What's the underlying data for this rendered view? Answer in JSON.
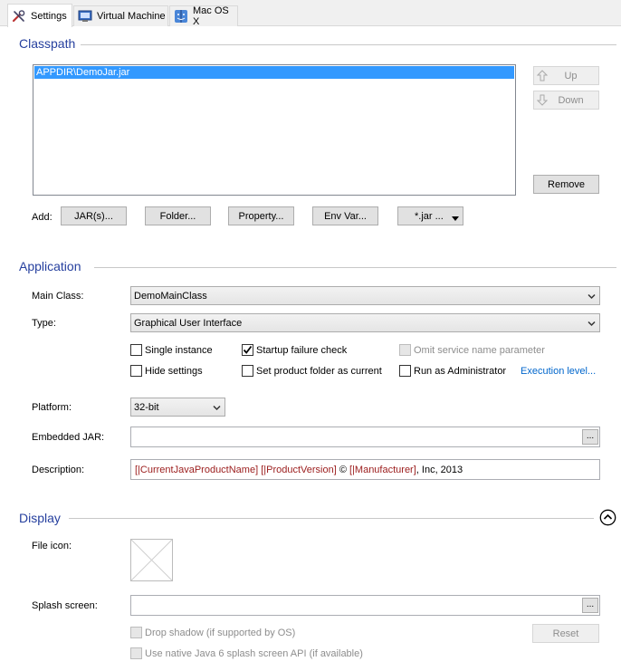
{
  "tabs": [
    {
      "label": "Settings",
      "icon": "wrench-screwdriver-icon"
    },
    {
      "label": "Virtual Machine",
      "icon": "virtual-machine-icon"
    },
    {
      "label": "Mac OS X",
      "icon": "mac-os-icon"
    }
  ],
  "classpath": {
    "title": "Classpath",
    "items": [
      "APPDIR\\DemoJar.jar"
    ],
    "up_label": "Up",
    "down_label": "Down",
    "remove_label": "Remove",
    "add_label": "Add:",
    "add_buttons": [
      "JAR(s)...",
      "Folder...",
      "Property...",
      "Env Var...",
      "*.jar ..."
    ]
  },
  "application": {
    "title": "Application",
    "main_class_label": "Main Class:",
    "main_class_value": "DemoMainClass",
    "type_label": "Type:",
    "type_value": "Graphical User Interface",
    "single_instance": "Single instance",
    "startup_failure_check": "Startup failure check",
    "omit_service_name": "Omit service name parameter",
    "hide_settings": "Hide settings",
    "set_product_folder": "Set product folder as current",
    "run_as_admin": "Run as Administrator",
    "execution_level": "Execution level...",
    "platform_label": "Platform:",
    "platform_value": "32-bit",
    "embedded_jar_label": "Embedded JAR:",
    "embedded_jar_value": "",
    "browse_label": "...",
    "description_label": "Description:",
    "description_parts": {
      "p1": "[|CurrentJavaProductName]",
      "p2": " ",
      "p3": "[|ProductVersion]",
      "p4": " © ",
      "p5": "[|Manufacturer]",
      "p6": ", Inc, 2013"
    }
  },
  "display": {
    "title": "Display",
    "file_icon_label": "File icon:",
    "splash_label": "Splash screen:",
    "splash_value": "",
    "browse_label": "...",
    "drop_shadow": "Drop shadow (if supported by OS)",
    "native_splash": "Use native Java 6 splash screen API (if available)",
    "reset_label": "Reset"
  },
  "colors": {
    "section_title": "#253f9e",
    "selection": "#3399ff",
    "link": "#0066cc",
    "description_variable": "#9b1c1c"
  }
}
